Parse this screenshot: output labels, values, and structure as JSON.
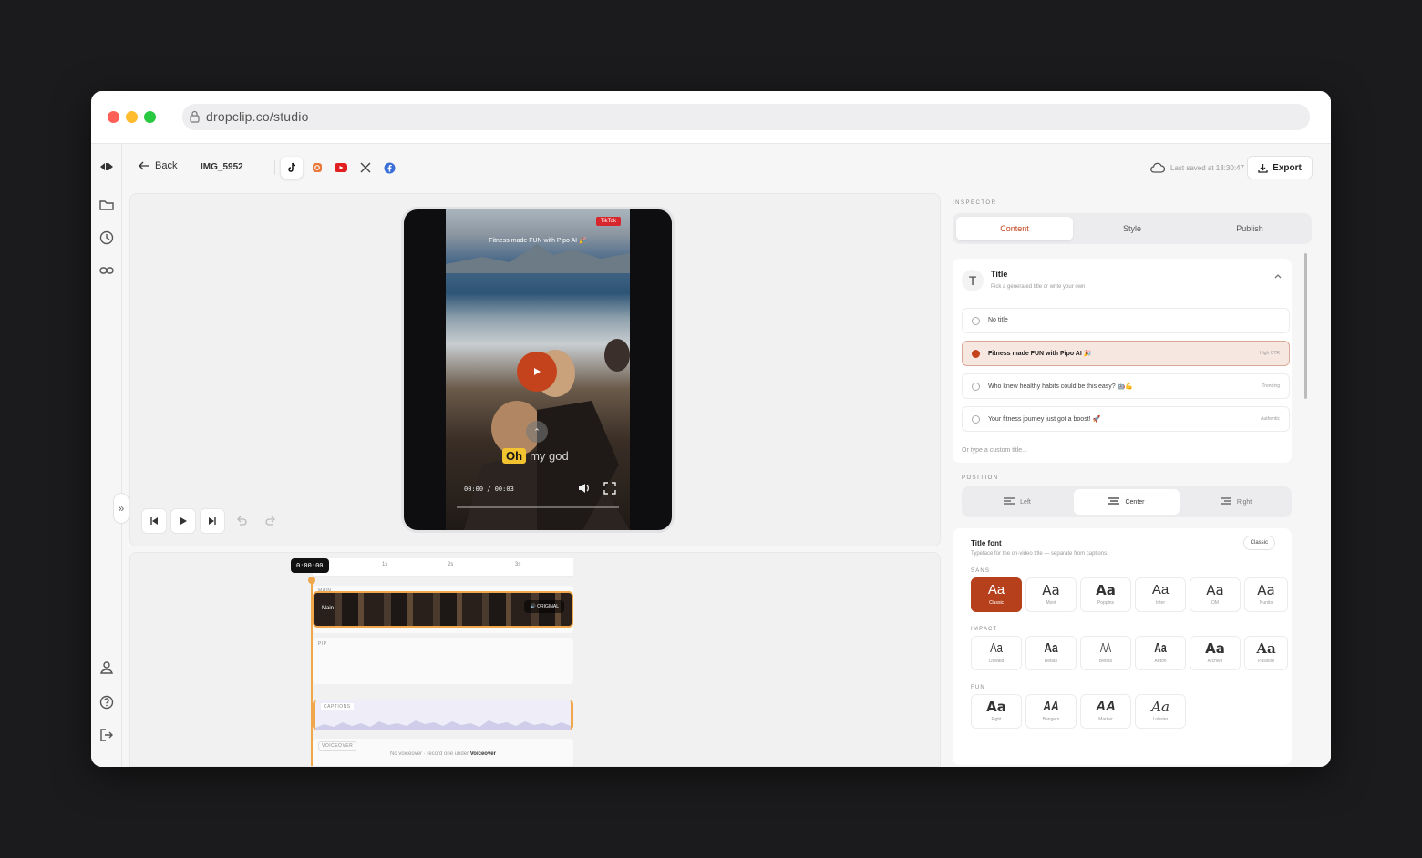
{
  "browser": {
    "url": "dropclip.co/studio"
  },
  "topbar": {
    "back_label": "Back",
    "file_name": "IMG_5952",
    "platforms": [
      "tiktok",
      "instagram",
      "youtube",
      "x",
      "facebook"
    ],
    "saved_text": "Last saved at 13:30:47",
    "export_label": "Export"
  },
  "video": {
    "platform_tag": "TikTok",
    "overlay_title": "Fitness made FUN with Pipo AI 🎉",
    "caption_highlight": "Oh",
    "caption_rest": "my god",
    "time": "00:00 / 00:03"
  },
  "timeline": {
    "playhead": "0:00:00",
    "ticks": [
      "1s",
      "2s",
      "3s"
    ],
    "tracks": {
      "main": "MAIN",
      "pip": "PIP",
      "captions": "CAPTIONS",
      "voiceover": "VOICEOVER"
    },
    "main_clip_label": "Main",
    "original_badge": "ORIGINAL",
    "vo_note_prefix": "No voiceover · record one under",
    "vo_note_link": "Voiceover"
  },
  "inspector": {
    "heading": "INSPECTOR",
    "tabs": [
      "Content",
      "Style",
      "Publish"
    ],
    "active_tab": "Content",
    "title_section": {
      "title": "Title",
      "subtitle": "Pick a generated title or write your own",
      "options": [
        {
          "label": "No title",
          "tag": ""
        },
        {
          "label": "Fitness made FUN with Pipo AI 🎉",
          "tag": "High CTR"
        },
        {
          "label": "Who knew healthy habits could be this easy? 🤖💪",
          "tag": "Trending"
        },
        {
          "label": "Your fitness journey just got a boost! 🚀",
          "tag": "Authentic"
        }
      ],
      "selected_index": 1,
      "custom_placeholder": "Or type a custom title..."
    },
    "position": {
      "label": "POSITION",
      "options": [
        "Left",
        "Center",
        "Right"
      ],
      "active": "Center"
    },
    "title_font": {
      "title": "Title font",
      "subtitle": "Typeface for the on-video title — separate from captions.",
      "badge": "Classic",
      "groups": [
        {
          "label": "SANS",
          "fonts": [
            {
              "glyph": "Aa",
              "name": "Classic"
            },
            {
              "glyph": "Aa",
              "name": "Mont"
            },
            {
              "glyph": "Aa",
              "name": "Poppins"
            },
            {
              "glyph": "Aa",
              "name": "Inter"
            },
            {
              "glyph": "Aa",
              "name": "DM"
            },
            {
              "glyph": "Aa",
              "name": "Nunito"
            }
          ]
        },
        {
          "label": "IMPACT",
          "fonts": [
            {
              "glyph": "Aa",
              "name": "Oswald"
            },
            {
              "glyph": "Aa",
              "name": "Bebas"
            },
            {
              "glyph": "AA",
              "name": "Bebas"
            },
            {
              "glyph": "Aa",
              "name": "Anton"
            },
            {
              "glyph": "Aa",
              "name": "Archivo"
            },
            {
              "glyph": "Aa",
              "name": "Passion"
            }
          ]
        },
        {
          "label": "FUN",
          "fonts": [
            {
              "glyph": "Aa",
              "name": "Fight"
            },
            {
              "glyph": "AA",
              "name": "Bangers"
            },
            {
              "glyph": "AA",
              "name": "Marker"
            },
            {
              "glyph": "Aa",
              "name": "Lobster"
            }
          ]
        }
      ],
      "selected": "Classic"
    }
  },
  "colors": {
    "accent": "#c4421c",
    "playhead": "#f0a64a",
    "caption_highlight": "#f2c230"
  }
}
